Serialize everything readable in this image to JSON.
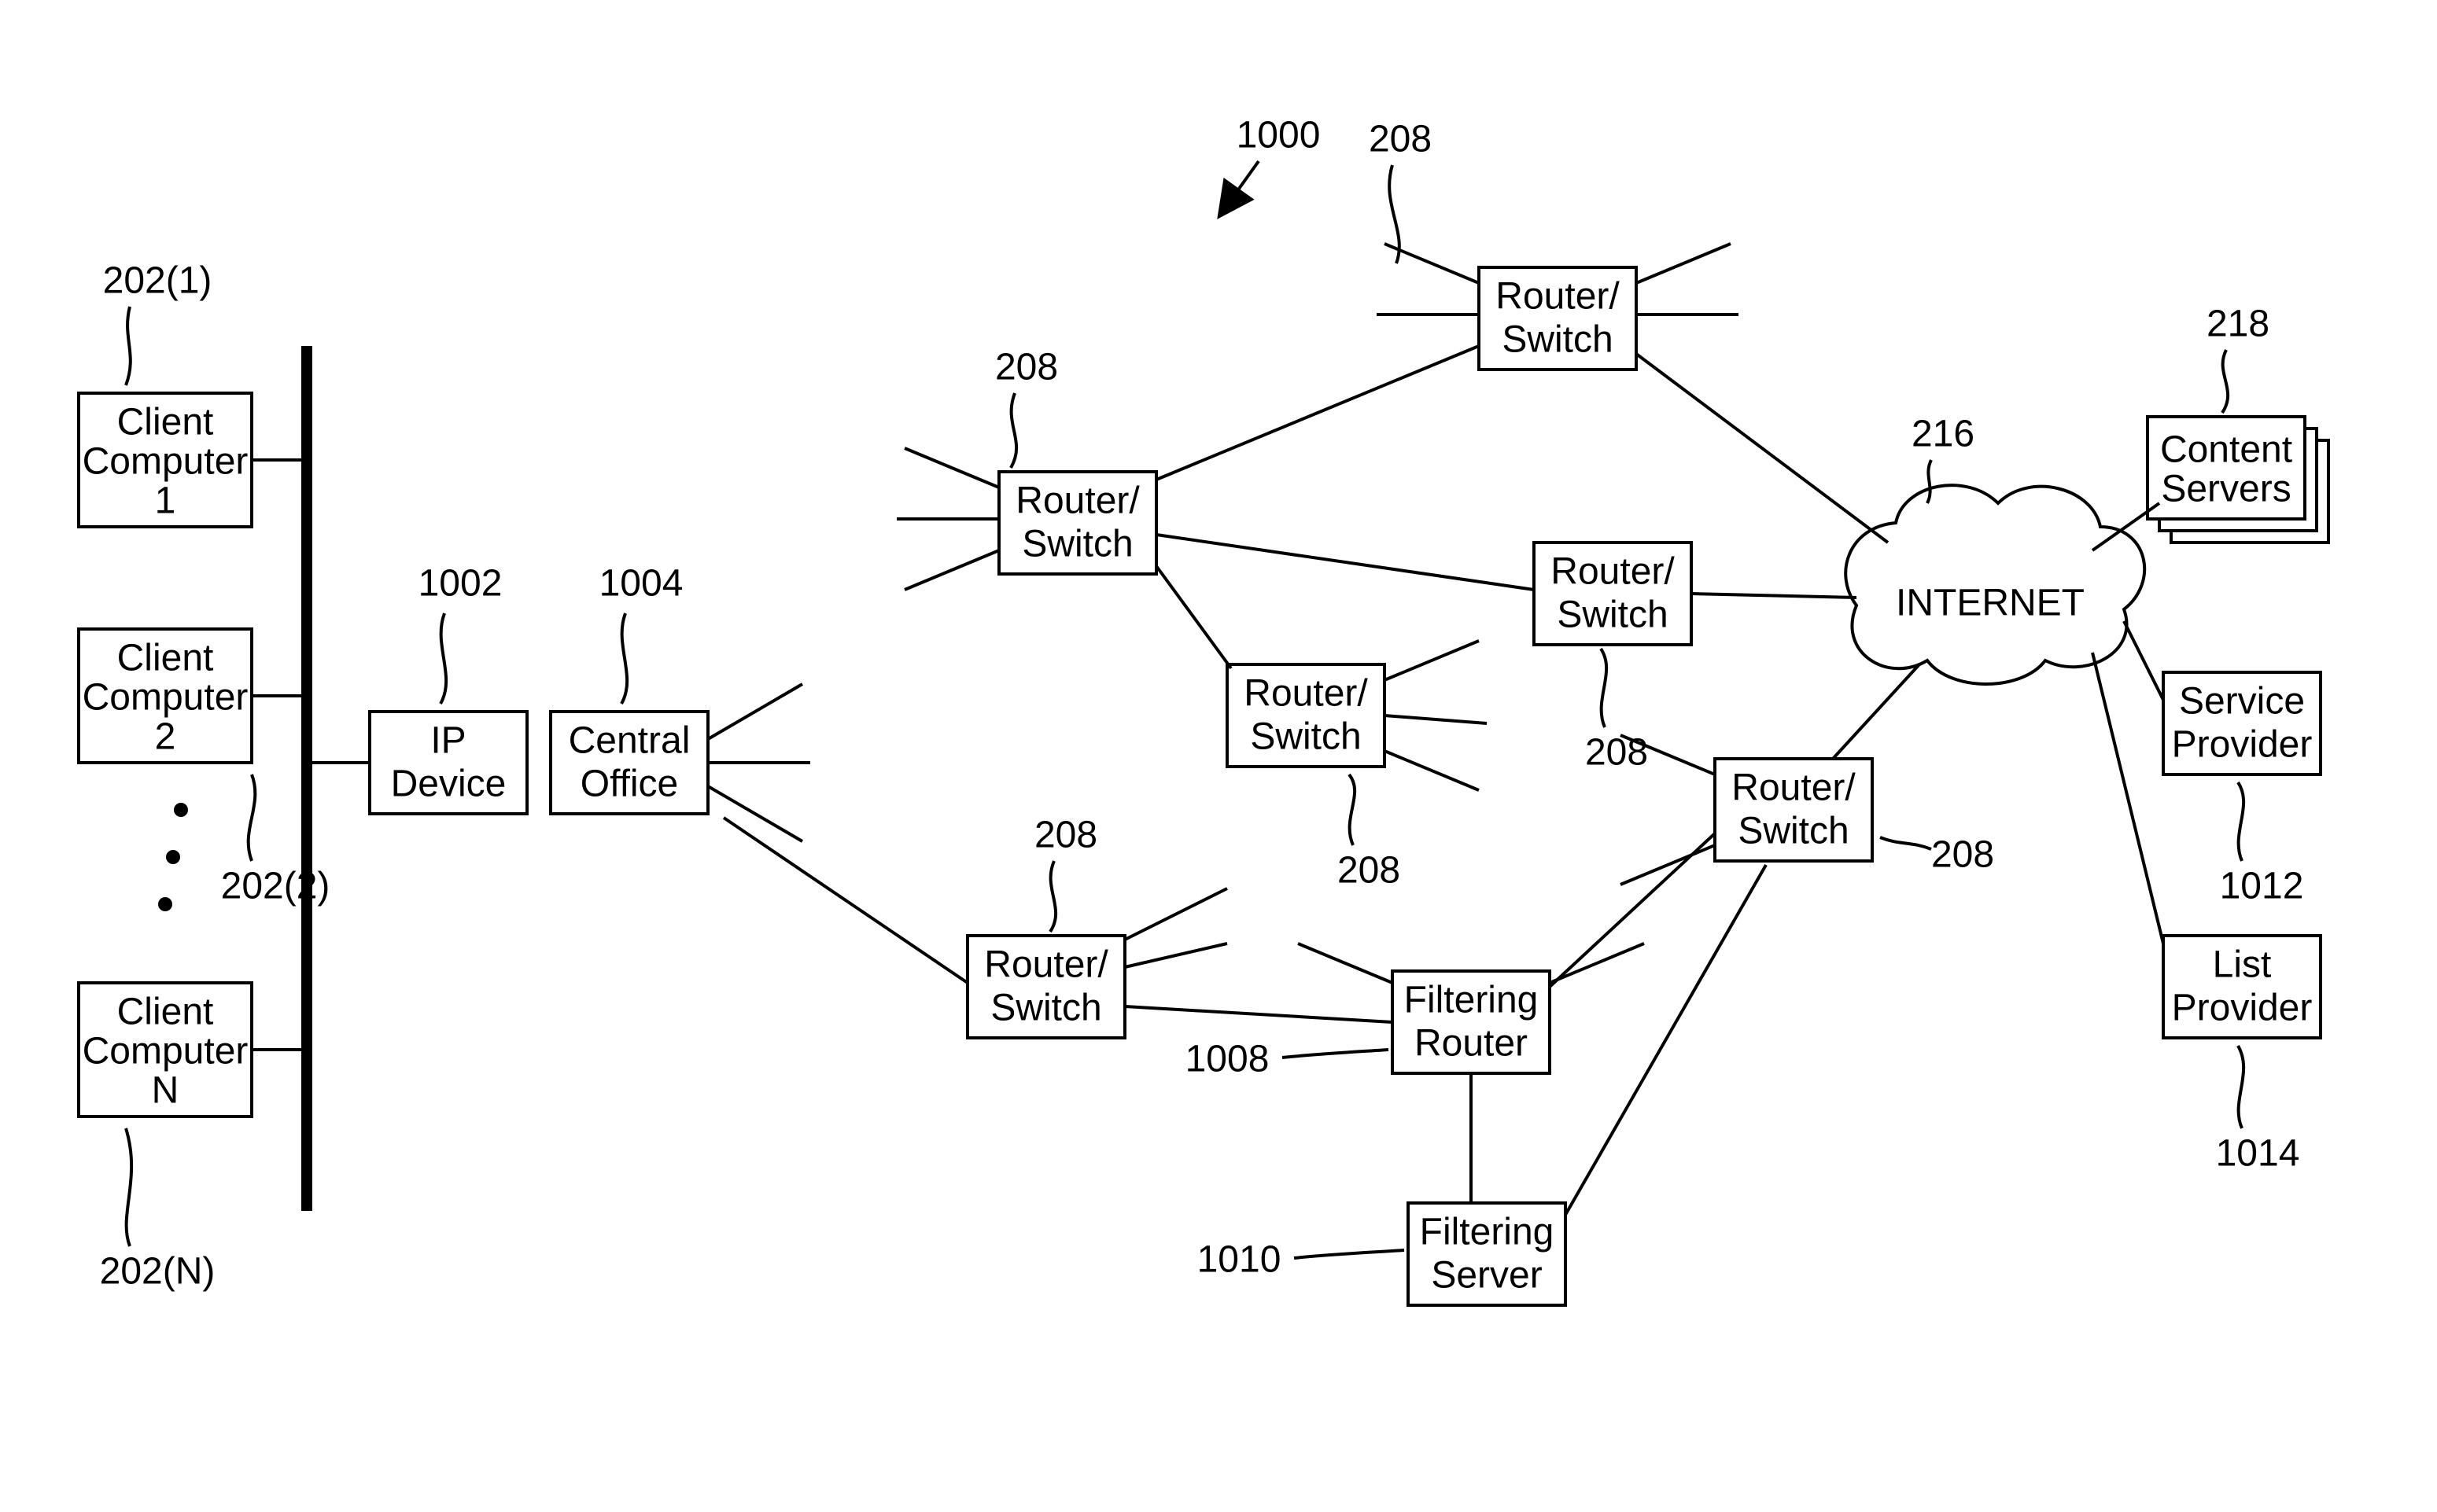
{
  "refs": {
    "client1": "202(1)",
    "client2": "202(2)",
    "clientN": "202(N)",
    "ipDevice": "1002",
    "centralOffice": "1004",
    "r1": "208",
    "r2": "208",
    "r3": "208",
    "r4": "208",
    "r5": "208",
    "r6": "208",
    "r7": "208",
    "filteringRouter": "1008",
    "filteringServer": "1010",
    "internet": "216",
    "contentServers": "218",
    "serviceProvider": "1012",
    "listProvider": "1014",
    "overall": "1000"
  },
  "labels": {
    "client1a": "Client",
    "client1b": "Computer",
    "client1c": "1",
    "client2a": "Client",
    "client2b": "Computer",
    "client2c": "2",
    "clientNa": "Client",
    "clientNb": "Computer",
    "clientNc": "N",
    "ipDeviceA": "IP",
    "ipDeviceB": "Device",
    "centralOfficeA": "Central",
    "centralOfficeB": "Office",
    "routerA": "Router/",
    "routerB": "Switch",
    "filteringRouterA": "Filtering",
    "filteringRouterB": "Router",
    "filteringServerA": "Filtering",
    "filteringServerB": "Server",
    "internet": "INTERNET",
    "contentServersA": "Content",
    "contentServersB": "Servers",
    "serviceProviderA": "Service",
    "serviceProviderB": "Provider",
    "listProviderA": "List",
    "listProviderB": "Provider"
  }
}
